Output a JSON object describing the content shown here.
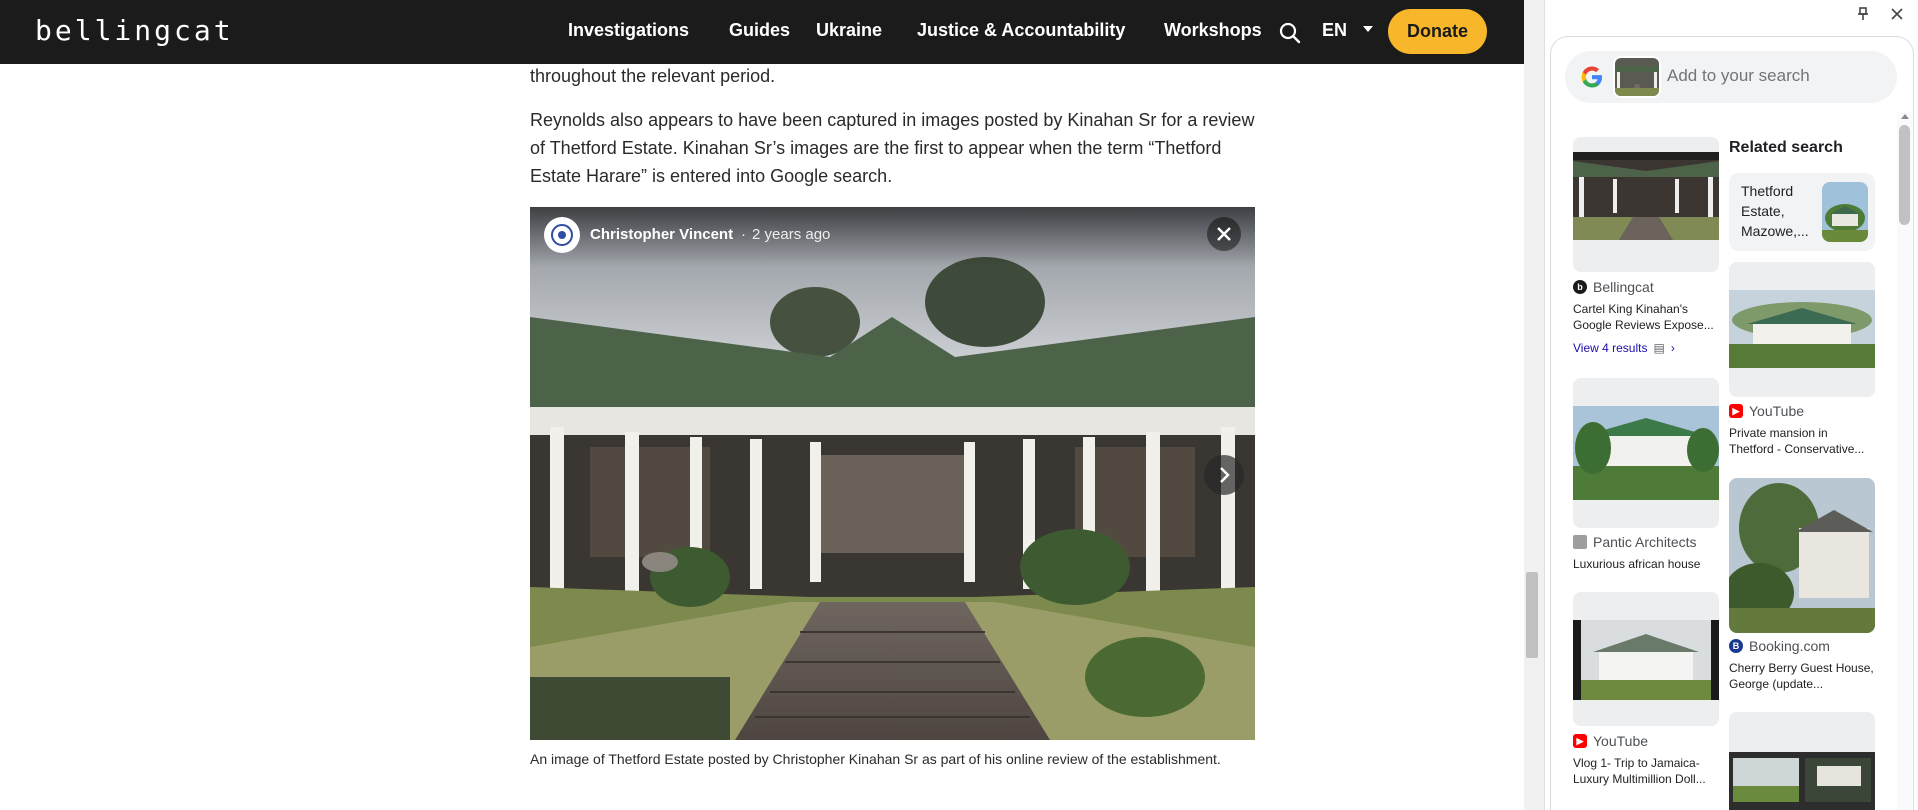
{
  "site": {
    "logo": "bellingcat",
    "nav": [
      "Investigations",
      "Guides",
      "Ukraine",
      "Justice & Accountability",
      "Workshops"
    ],
    "language": "EN",
    "donate_label": "Donate"
  },
  "article": {
    "para1": "throughout the relevant period.",
    "para2": "Reynolds also appears to have been captured in images posted by Kinahan Sr for a review of Thetford Estate. Kinahan Sr’s images are the first to appear when the term “Thetford Estate Harare” is entered into Google search.",
    "figure": {
      "author": "Christopher Vincent",
      "separator": "·",
      "time": "2 years ago",
      "caption": "An image of Thetford Estate posted by Christopher Kinahan Sr as part of his online review of the establishment."
    }
  },
  "lens": {
    "search_placeholder": "Add to your search",
    "related_heading": "Related search",
    "related_chip": "Thetford Estate, Mazowe,...",
    "results": [
      {
        "source": "Bellingcat",
        "title": "Cartel King Kinahan's Google Reviews Expose...",
        "extra": "View 4 results",
        "icon_color": "#1b1b1b"
      },
      {
        "source": "YouTube",
        "title": "Private mansion in Thetford - Conservative...",
        "icon_color": "#ff0000"
      },
      {
        "source": "Pantic Architects",
        "title": "Luxurious african house",
        "icon_color": "#9e9e9e"
      },
      {
        "source": "Booking.com",
        "title": "Cherry Berry Guest House, George (update...",
        "icon_color": "#1a3a8f"
      },
      {
        "source": "YouTube",
        "title": "Vlog 1- Trip to Jamaica- Luxury Multimillion Doll...",
        "icon_color": "#ff0000"
      }
    ]
  },
  "icons": {
    "search": "search-icon",
    "close": "close-icon",
    "next": "chevron-right-icon",
    "pin": "pin-icon"
  },
  "colors": {
    "nav_bg": "#1b1b1b",
    "donate": "#f8b72a",
    "link": "#1a0dab"
  }
}
